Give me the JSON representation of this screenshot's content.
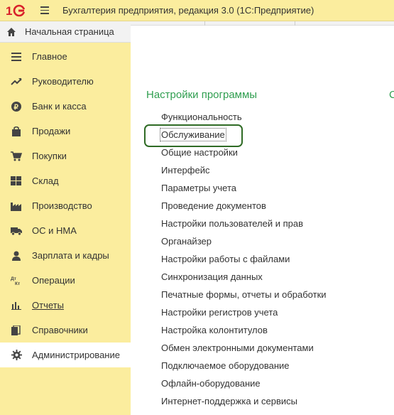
{
  "window": {
    "title": "Бухгалтерия предприятия, редакция 3.0  (1С:Предприятие)"
  },
  "sidebar": {
    "home_label": "Начальная страница",
    "items": [
      {
        "label": "Главное",
        "icon": "list-icon"
      },
      {
        "label": "Руководителю",
        "icon": "trend-icon"
      },
      {
        "label": "Банк и касса",
        "icon": "ruble-icon"
      },
      {
        "label": "Продажи",
        "icon": "bag-icon"
      },
      {
        "label": "Покупки",
        "icon": "cart-icon"
      },
      {
        "label": "Склад",
        "icon": "warehouse-icon"
      },
      {
        "label": "Производство",
        "icon": "factory-icon"
      },
      {
        "label": "ОС и НМА",
        "icon": "truck-icon"
      },
      {
        "label": "Зарплата и кадры",
        "icon": "person-icon"
      },
      {
        "label": "Операции",
        "icon": "dt-kt-icon"
      },
      {
        "label": "Отчеты",
        "icon": "bar-chart-icon"
      },
      {
        "label": "Справочники",
        "icon": "books-icon"
      },
      {
        "label": "Администрирование",
        "icon": "gear-icon"
      }
    ]
  },
  "main": {
    "section_title": "Настройки программы",
    "section_title_2": "С",
    "links": [
      "Функциональность",
      "Обслуживание",
      "Общие настройки",
      "Интерфейс",
      "Параметры учета",
      "Проведение документов",
      "Настройки пользователей и прав",
      "Органайзер",
      "Настройки работы с файлами",
      "Синхронизация данных",
      "Печатные формы, отчеты и обработки",
      "Настройки регистров учета",
      "Настройка колонтитулов",
      "Обмен электронными документами",
      "Подключаемое оборудование",
      "Офлайн-оборудование",
      "Интернет-поддержка и сервисы"
    ]
  },
  "colors": {
    "sidebar_bg": "#fbed9e",
    "accent_green": "#2f9e4f",
    "highlight_border": "#2f6b25",
    "logo_red": "#d8202a"
  }
}
